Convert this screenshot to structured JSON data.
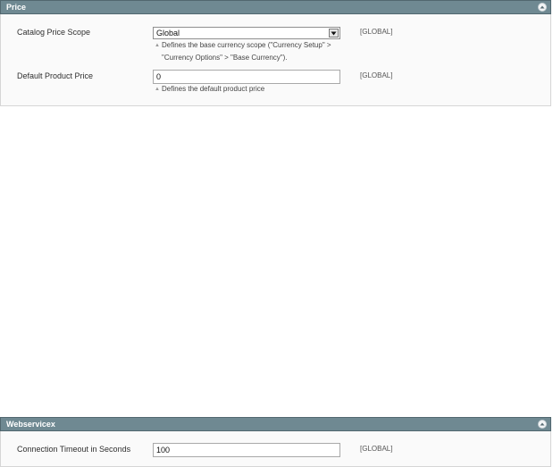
{
  "price_section": {
    "title": "Price",
    "catalog_price_scope": {
      "label": "Catalog Price Scope",
      "selected": "Global",
      "scope": "[GLOBAL]",
      "note_line1": "Defines the base currency scope (\"Currency Setup\" >",
      "note_line2": "\"Currency Options\" > \"Base Currency\")."
    },
    "default_product_price": {
      "label": "Default Product Price",
      "value": "0",
      "scope": "[GLOBAL]",
      "note": "Defines the default product price"
    }
  },
  "webservicex_section": {
    "title": "Webservicex",
    "connection_timeout": {
      "label": "Connection Timeout in Seconds",
      "value": "100",
      "scope": "[GLOBAL]"
    }
  },
  "icons": {
    "collapse": "collapse-up-icon",
    "dropdown": "chevron-down-icon",
    "note": "note-triangle-icon"
  }
}
